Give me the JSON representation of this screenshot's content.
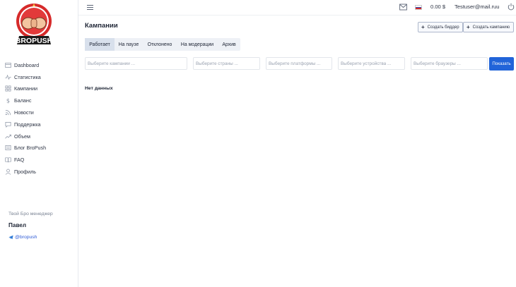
{
  "logo": {
    "text": "BROPUSH"
  },
  "sidebar": {
    "items": [
      {
        "label": "Dashboard",
        "icon": "dashboard-icon"
      },
      {
        "label": "Статистика",
        "icon": "stats-icon"
      },
      {
        "label": "Кампании",
        "icon": "campaigns-icon"
      },
      {
        "label": "Баланс",
        "icon": "dollar-icon"
      },
      {
        "label": "Новости",
        "icon": "rss-icon"
      },
      {
        "label": "Поддержка",
        "icon": "chat-icon"
      },
      {
        "label": "Объем",
        "icon": "trend-icon"
      },
      {
        "label": "Блог BroPush",
        "icon": "blog-icon"
      },
      {
        "label": "FAQ",
        "icon": "book-icon"
      },
      {
        "label": "Профиль",
        "icon": "user-icon"
      }
    ],
    "manager": {
      "title": "Твой Бро менеджер",
      "name": "Павел",
      "telegram": "@bropush"
    }
  },
  "header": {
    "balance": "0.00 $",
    "email": "Testuser@mail.ruu"
  },
  "main": {
    "title": "Кампании",
    "create_bidder": "Создать биддер",
    "create_campaign": "Создать кампанию",
    "tabs": [
      "Работает",
      "На паузе",
      "Отклонено",
      "На модерации",
      "Архив"
    ],
    "filters": {
      "campaigns": "Выберите кампании ...",
      "countries": "Выберите страны ...",
      "platforms": "Выберите платформы ...",
      "devices": "Выберите устройства ...",
      "browsers": "Выберите браузеры ..."
    },
    "show_button": "Показать",
    "empty_text": "Нет данных"
  },
  "colors": {
    "primary": "#2164d9",
    "text": "#1e2535",
    "muted": "#9aa2b0"
  }
}
